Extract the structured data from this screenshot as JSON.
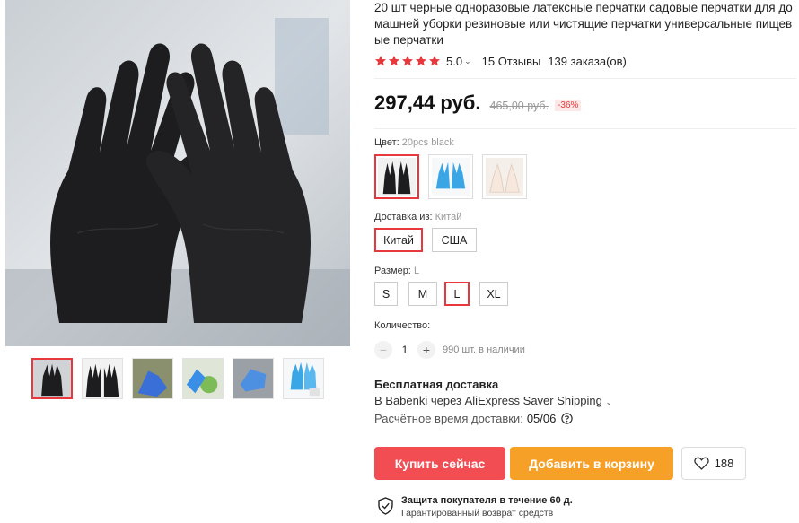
{
  "product": {
    "title": "20 шт черные одноразовые латексные перчатки садовые перчатки для домашней уборки резиновые или чистящие перчатки универсальные пищевые перчатки",
    "rating": "5.0",
    "reviews": "15 Отзывы",
    "orders": "139 заказа(ов)",
    "price": "297,44 руб.",
    "old_price": "465,00 руб.",
    "discount": "-36%"
  },
  "gallery": {
    "thumbnails": [
      "black-gloves-pair",
      "black-gloves-open",
      "blue-gloves-hand",
      "blue-gloves-kitchen",
      "blue-glove-single",
      "blue-gloves-package"
    ]
  },
  "color": {
    "label": "Цвет:",
    "selected": "20pcs black",
    "options": [
      "black",
      "blue",
      "white"
    ]
  },
  "ship_from": {
    "label": "Доставка из:",
    "selected": "Китай",
    "options": [
      "Китай",
      "США"
    ]
  },
  "size": {
    "label": "Размер:",
    "selected": "L",
    "options": [
      "S",
      "M",
      "L",
      "XL"
    ]
  },
  "quantity": {
    "label": "Количество:",
    "value": "1",
    "minus": "−",
    "plus": "+",
    "stock": "990 шт. в наличии"
  },
  "shipping": {
    "title": "Бесплатная доставка",
    "line": "В Babenki через AliExpress Saver Shipping",
    "eta_label": "Расчётное время доставки:",
    "eta_value": "05/06"
  },
  "actions": {
    "buy": "Купить сейчас",
    "cart": "Добавить в корзину",
    "wishlist_count": "188"
  },
  "protection": {
    "title": "Защита покупателя в течение 60 д.",
    "subtitle": "Гарантированный возврат средств"
  },
  "colors": {
    "accent": "#e8383d",
    "buy": "#f24d53",
    "cart": "#f7a028",
    "glove_black": "#1d1d1f",
    "glove_blue": "#3aa6e6"
  }
}
